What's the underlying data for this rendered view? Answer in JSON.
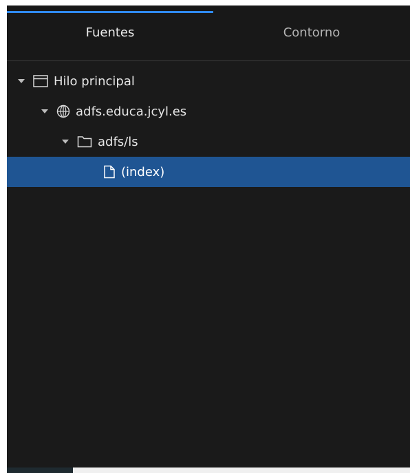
{
  "tabs": {
    "sources_label": "Fuentes",
    "outline_label": "Contorno",
    "active": "Fuentes"
  },
  "tree": {
    "main_thread": "Hilo principal",
    "domain": "adfs.educa.jcyl.es",
    "folder": "adfs/ls",
    "file": "(index)"
  },
  "colors": {
    "panel_bg": "#1a1a1a",
    "active_tab_indicator": "#2f8af0",
    "selected_row": "#1f5593"
  },
  "icons": {
    "main_thread": "window-icon",
    "domain": "globe-icon",
    "folder": "folder-icon",
    "file": "file-icon",
    "expand": "caret-down-icon"
  }
}
